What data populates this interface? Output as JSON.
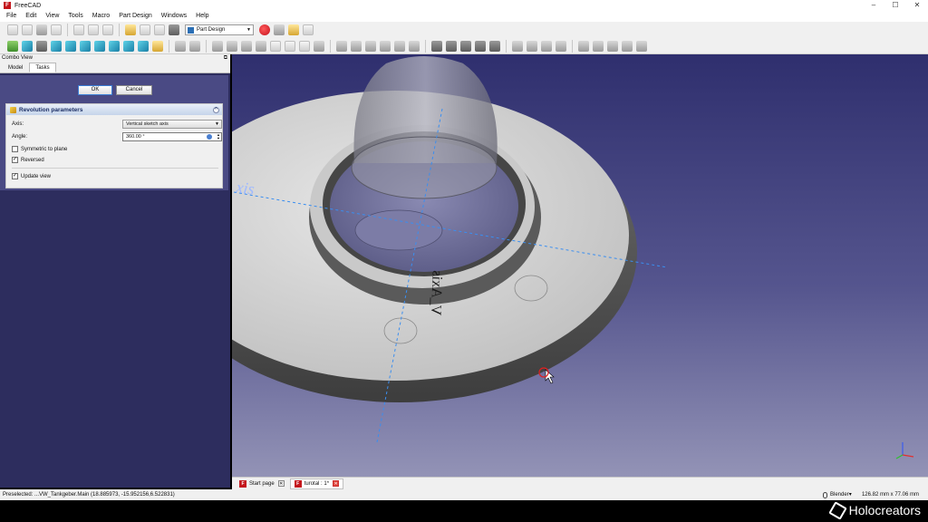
{
  "window": {
    "title": "FreeCAD",
    "icon": "freecad-icon",
    "controls": [
      "–",
      "☐",
      "✕"
    ]
  },
  "menu": [
    "File",
    "Edit",
    "View",
    "Tools",
    "Macro",
    "Part Design",
    "Windows",
    "Help"
  ],
  "toolbar": {
    "workbench": "Part Design"
  },
  "combo_view": {
    "title": "Combo View",
    "tabs": [
      "Model",
      "Tasks"
    ],
    "active_tab": "Tasks",
    "ok_label": "OK",
    "cancel_label": "Cancel"
  },
  "revolution": {
    "title": "Revolution parameters",
    "axis_label": "Axis:",
    "axis_value": "Vertical sketch axis",
    "angle_label": "Angle:",
    "angle_value": "360.00 °",
    "symmetric_label": "Symmetric to plane",
    "symmetric_checked": false,
    "reversed_label": "Reversed",
    "reversed_checked": true,
    "update_label": "Update view",
    "update_checked": true
  },
  "viewport": {
    "label_axis": "xis",
    "label_vaxis": "V_Axis",
    "colors": {
      "bg_top": "#2f2f6e",
      "bg_bottom": "#9393b6",
      "axis_line": "#3a8ef0"
    }
  },
  "doc_tabs": [
    {
      "label": "Start page",
      "active": false
    },
    {
      "label": "turotal : 1*",
      "active": true
    }
  ],
  "status": {
    "message": "Preselected: ...VW_Tankgeber.Main (18.885973, -15.952156,6.522831)",
    "nav_style": "Blender",
    "dimensions": "126.82 mm x 77.06 mm"
  },
  "watermark": "Holocreators"
}
